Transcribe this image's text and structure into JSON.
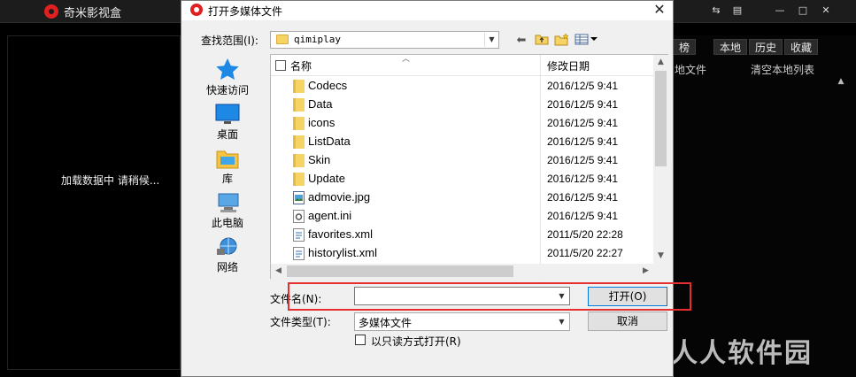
{
  "app": {
    "title": "奇米影视盒",
    "loading_text": "加载数据中 请稍候...",
    "tabs": [
      "榜",
      "本地",
      "历史",
      "收藏"
    ],
    "links": [
      "地文件",
      "清空本地列表"
    ],
    "window_controls": [
      "menu-icon",
      "skin-icon",
      "minimize-icon",
      "maximize-icon",
      "close-icon"
    ]
  },
  "watermark": "人人软件园",
  "dialog": {
    "title": "打开多媒体文件",
    "look_in_label": "查找范围(I):",
    "look_in_value": "qimiplay",
    "toolbar": [
      "back-icon",
      "up-folder-icon",
      "new-folder-icon",
      "view-menu-icon"
    ],
    "places": [
      {
        "label": "快速访问",
        "icon": "quick-access-star-icon"
      },
      {
        "label": "桌面",
        "icon": "desktop-icon"
      },
      {
        "label": "库",
        "icon": "library-icon"
      },
      {
        "label": "此电脑",
        "icon": "this-pc-icon"
      },
      {
        "label": "网络",
        "icon": "network-icon"
      }
    ],
    "columns": {
      "name": "名称",
      "date": "修改日期"
    },
    "files": [
      {
        "name": "Codecs",
        "date": "2016/12/5 9:41",
        "type": "folder"
      },
      {
        "name": "Data",
        "date": "2016/12/5 9:41",
        "type": "folder"
      },
      {
        "name": "icons",
        "date": "2016/12/5 9:41",
        "type": "folder"
      },
      {
        "name": "ListData",
        "date": "2016/12/5 9:41",
        "type": "folder"
      },
      {
        "name": "Skin",
        "date": "2016/12/5 9:41",
        "type": "folder"
      },
      {
        "name": "Update",
        "date": "2016/12/5 9:41",
        "type": "folder"
      },
      {
        "name": "admovie.jpg",
        "date": "2016/12/5 9:41",
        "type": "image"
      },
      {
        "name": "agent.ini",
        "date": "2016/12/5 9:41",
        "type": "settings"
      },
      {
        "name": "favorites.xml",
        "date": "2011/5/20 22:28",
        "type": "xml"
      },
      {
        "name": "historylist.xml",
        "date": "2011/5/20 22:27",
        "type": "xml"
      }
    ],
    "filename_label": "文件名(N):",
    "filename_value": "",
    "filetype_label": "文件类型(T):",
    "filetype_value": "多媒体文件",
    "open_button": "打开(O)",
    "cancel_button": "取消",
    "readonly_label": "以只读方式打开(R)",
    "highlight_color": "#e52e2e"
  }
}
